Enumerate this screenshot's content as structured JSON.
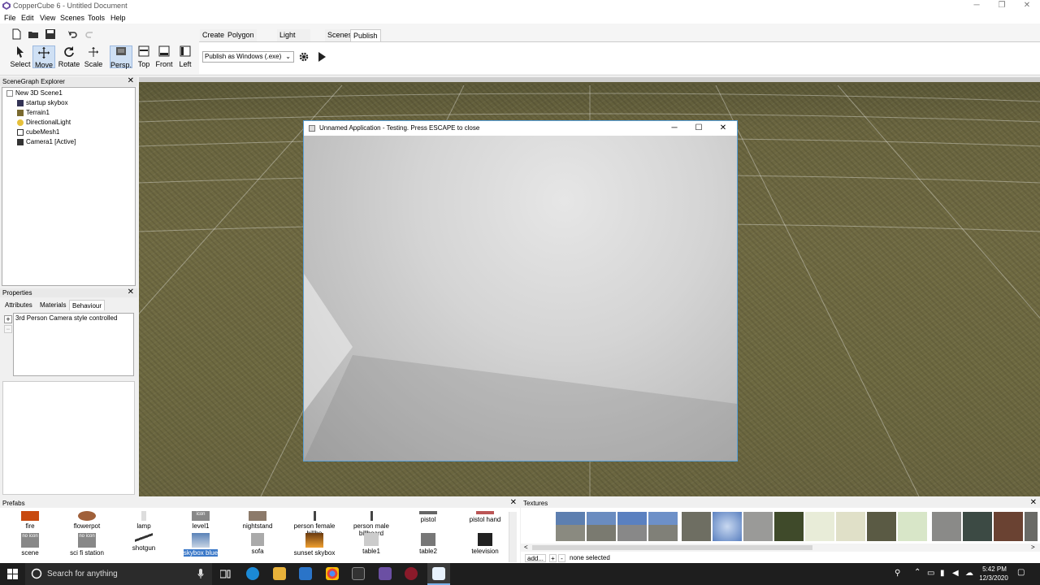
{
  "window": {
    "title": "CopperCube 6 - Untitled Document",
    "minimize": "─",
    "restore": "❐",
    "close": "✕"
  },
  "menu": [
    "File",
    "Edit",
    "View",
    "Scenes",
    "Tools",
    "Help"
  ],
  "toolbar": {
    "tools": [
      {
        "label": "Select",
        "icon": "cursor-icon"
      },
      {
        "label": "Move",
        "icon": "move-icon",
        "active": true
      },
      {
        "label": "Rotate",
        "icon": "rotate-icon"
      },
      {
        "label": "Scale",
        "icon": "scale-icon"
      },
      {
        "label": "Persp.",
        "icon": "perspective-icon",
        "active": true
      },
      {
        "label": "Top",
        "icon": "top-view-icon"
      },
      {
        "label": "Front",
        "icon": "front-view-icon"
      },
      {
        "label": "Left",
        "icon": "left-view-icon"
      }
    ],
    "tabs": [
      "Create",
      "Polygon Editing",
      "Light Mapping",
      "Scenes",
      "Publish"
    ],
    "active_tab": "Publish",
    "publish_target": "Publish as Windows (.exe)"
  },
  "scenegraph": {
    "title": "SceneGraph Explorer",
    "close": "✕",
    "nodes": [
      "New 3D Scene1",
      "startup skybox",
      "Terrain1",
      "DirectionalLight",
      "cubeMesh1",
      "Camera1 [Active]"
    ]
  },
  "properties": {
    "title": "Properties",
    "close": "✕",
    "tabs": [
      "Attributes",
      "Materials",
      "Behaviour"
    ],
    "active_tab": "Behaviour",
    "add": "+",
    "remove": "−",
    "behaviours": [
      "3rd Person Camera style controlled"
    ]
  },
  "testwindow": {
    "title": "Unnamed Application - Testing. Press ESCAPE to close",
    "minimize": "─",
    "maximize": "☐",
    "close": "✕"
  },
  "prefabs": {
    "title": "Prefabs",
    "close": "✕",
    "no_icon": "no icon",
    "icon_text": "icon",
    "row1": [
      "fire",
      "flowerpot",
      "lamp",
      "level1",
      "nightstand",
      "person female billbo",
      "person male billboard",
      "pistol",
      "pistol hand"
    ],
    "row2": [
      "scene",
      "sci fi station",
      "shotgun",
      "skybox blue",
      "sofa",
      "sunset skybox",
      "table1",
      "table2",
      "television"
    ],
    "selected": "skybox blue"
  },
  "textures": {
    "title": "Textures",
    "close": "✕",
    "add": "add...",
    "plus": "+",
    "minus": "-",
    "status": "none selected",
    "scroll_left": "<",
    "scroll_right": ">"
  },
  "taskbar": {
    "search_placeholder": "Search for anything",
    "time": "5:42 PM",
    "date": "12/3/2020"
  },
  "colors": {
    "accent": "#3a78c8",
    "window_border": "#5aa0d8",
    "taskbar": "#1e1e1e"
  }
}
